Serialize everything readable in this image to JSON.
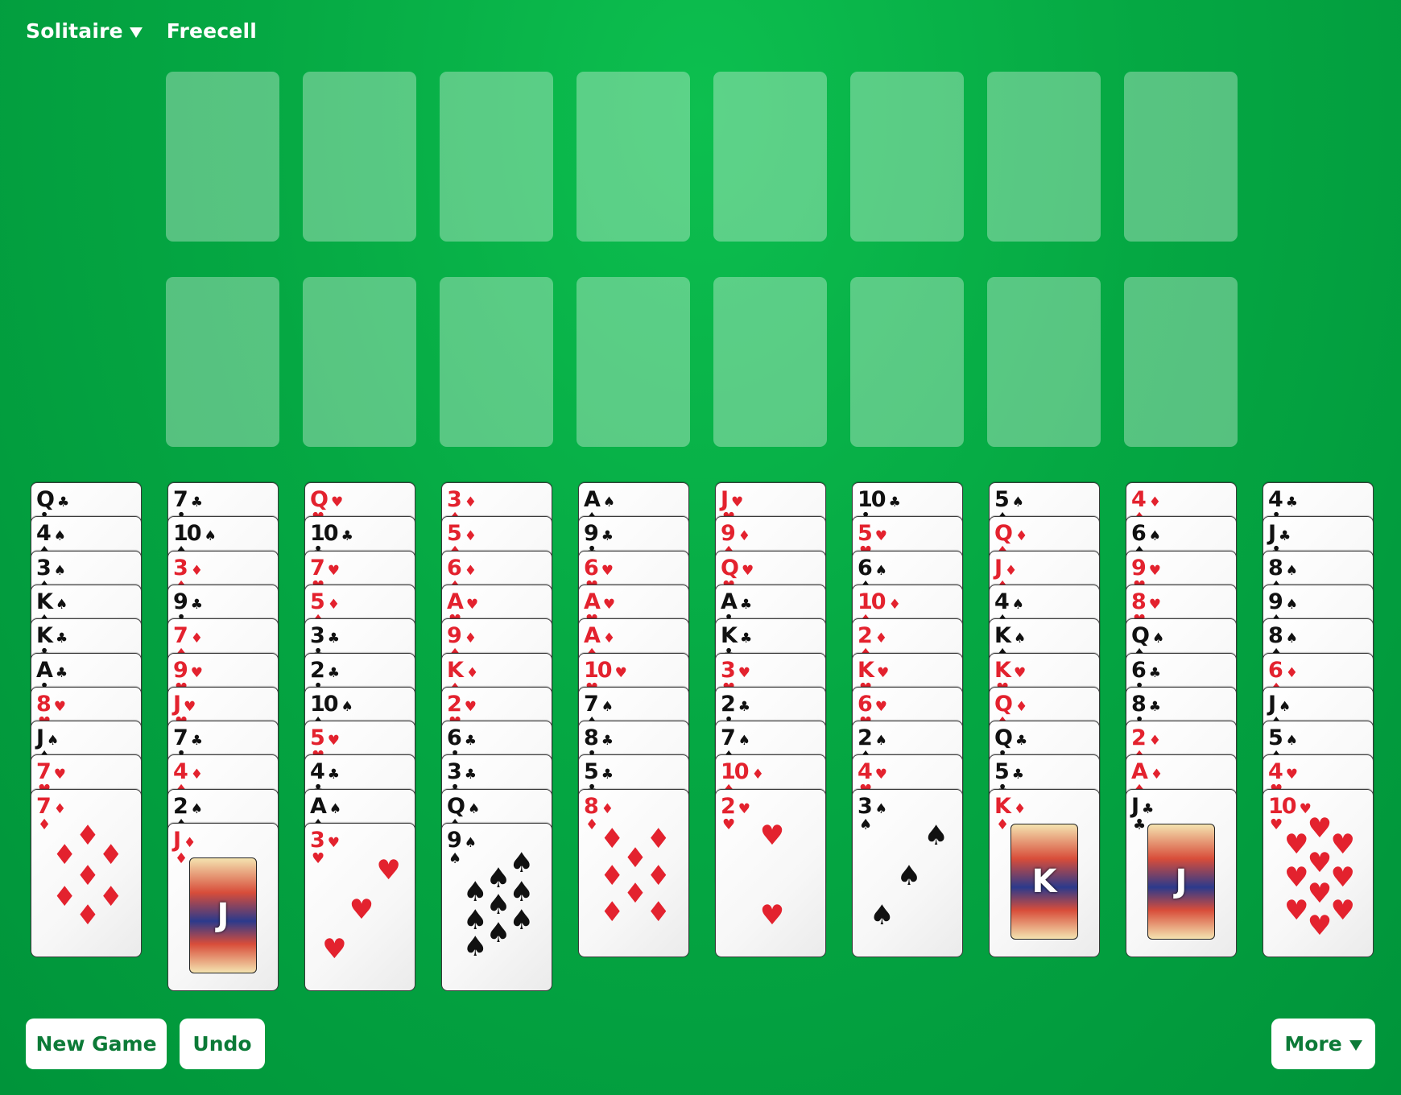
{
  "nav": {
    "solitaire_label": "Solitaire",
    "freecell_label": "Freecell"
  },
  "icons": {
    "dropdown": "caret-down-icon"
  },
  "colors": {
    "felt": "#05a843",
    "red_suit": "#e3222e",
    "black_suit": "#111111",
    "button_text": "#0c7a37"
  },
  "suit_glyphs": {
    "S": "♠",
    "C": "♣",
    "H": "♥",
    "D": "♦"
  },
  "top_slots": {
    "rows": 2,
    "per_row": 8,
    "row1_label": "free-cells",
    "row2_label": "foundations"
  },
  "columns": [
    {
      "cards": [
        "Q♣",
        "4♠",
        "3♠",
        "K♠",
        "K♣",
        "A♣",
        "8♥",
        "J♠",
        "7♥",
        "7♦"
      ]
    },
    {
      "cards": [
        "7♣",
        "10♠",
        "3♦",
        "9♣",
        "7♦",
        "9♥",
        "J♥",
        "7♣",
        "4♦",
        "2♠",
        "J♦"
      ]
    },
    {
      "cards": [
        "Q♥",
        "10♣",
        "7♥",
        "5♦",
        "3♣",
        "2♣",
        "10♠",
        "5♥",
        "4♣",
        "A♠",
        "3♥"
      ]
    },
    {
      "cards": [
        "3♦",
        "5♦",
        "6♦",
        "A♥",
        "9♦",
        "K♦",
        "2♥",
        "6♣",
        "3♣",
        "Q♠",
        "9♠"
      ]
    },
    {
      "cards": [
        "A♠",
        "9♣",
        "6♥",
        "A♥",
        "A♦",
        "10♥",
        "7♠",
        "8♣",
        "5♣",
        "8♦"
      ]
    },
    {
      "cards": [
        "J♥",
        "9♦",
        "Q♥",
        "A♣",
        "K♣",
        "3♥",
        "2♣",
        "7♠",
        "10♦",
        "2♥"
      ]
    },
    {
      "cards": [
        "10♣",
        "5♥",
        "6♠",
        "10♦",
        "2♦",
        "K♥",
        "6♥",
        "2♠",
        "4♥",
        "3♠"
      ]
    },
    {
      "cards": [
        "5♠",
        "Q♦",
        "J♦",
        "4♠",
        "K♠",
        "K♥",
        "Q♦",
        "Q♣",
        "5♣",
        "K♦"
      ]
    },
    {
      "cards": [
        "4♦",
        "6♠",
        "9♥",
        "8♥",
        "Q♠",
        "6♣",
        "8♣",
        "2♦",
        "A♦",
        "J♣"
      ]
    },
    {
      "cards": [
        "4♣",
        "J♣",
        "8♠",
        "9♠",
        "8♠",
        "6♦",
        "J♠",
        "5♠",
        "4♥",
        "10♥"
      ]
    }
  ],
  "buttons": {
    "new_game": "New Game",
    "undo": "Undo",
    "more": "More"
  }
}
